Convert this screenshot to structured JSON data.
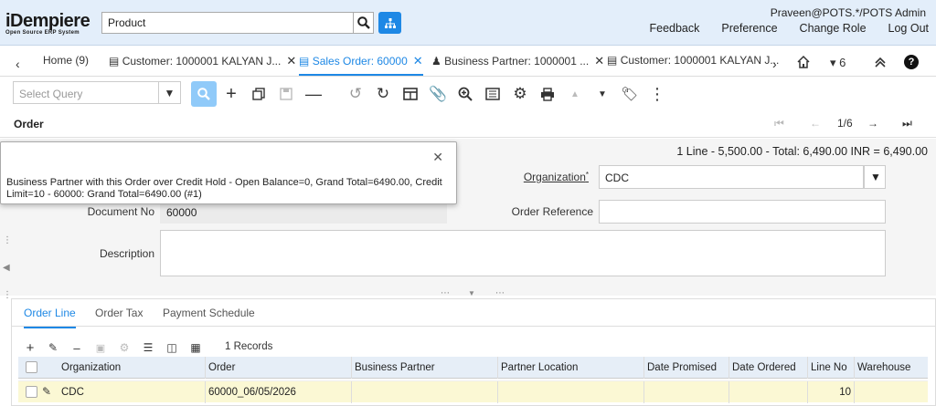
{
  "header": {
    "logo_main": "iDempiere",
    "logo_sub": "Open Source ERP System",
    "search_value": "Product",
    "user": "Praveen@POTS.*/POTS Admin",
    "links": [
      "Feedback",
      "Preference",
      "Change Role",
      "Log Out"
    ]
  },
  "tabs": {
    "items": [
      {
        "label": "Home (9)"
      },
      {
        "label": "Customer: 1000001 KALYAN J..."
      },
      {
        "label": "Sales Order: 60000"
      },
      {
        "label": "Business Partner: 1000001 ..."
      },
      {
        "label": "Customer: 1000001 KALYAN J..."
      }
    ],
    "active_index": 2,
    "count_label": "6"
  },
  "toolbar": {
    "query_placeholder": "Select Query"
  },
  "crumb": {
    "title": "Order",
    "position": "1/6"
  },
  "form": {
    "totals": "1 Line - 5,500.00 - Total: 6,490.00 INR = 6,490.00",
    "organization_label": "Organization",
    "organization_value": "CDC",
    "document_no_label": "Document No",
    "document_no_value": "60000",
    "order_reference_label": "Order Reference",
    "order_reference_value": "",
    "description_label": "Description",
    "description_value": ""
  },
  "popup": {
    "message": "Business Partner with this Order over Credit Hold - Open Balance=0, Grand Total=6490.00, Credit Limit=10 - 60000: Grand Total=6490.00 (#1)"
  },
  "detail": {
    "tabs": [
      "Order Line",
      "Order Tax",
      "Payment Schedule"
    ],
    "records": "1 Records",
    "columns": [
      "Organization",
      "Order",
      "Business Partner",
      "Partner Location",
      "Date Promised",
      "Date Ordered",
      "Line No",
      "Warehouse"
    ],
    "rows": [
      {
        "organization": "CDC",
        "order": "60000_06/05/2026",
        "business_partner": "",
        "partner_location": "",
        "date_promised": "",
        "date_ordered": "",
        "line_no": "10",
        "warehouse": ""
      }
    ]
  },
  "colors": {
    "accent": "#1e88e5",
    "header_bg": "#e3eefa",
    "selected_row": "#fbf8d4"
  }
}
